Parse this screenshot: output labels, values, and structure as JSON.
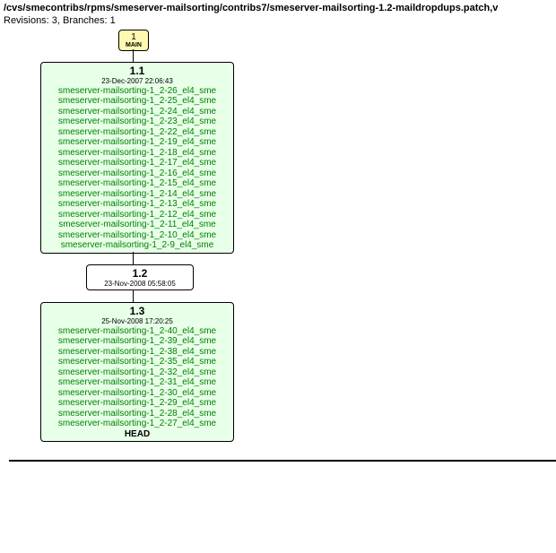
{
  "header": {
    "path": "/cvs/smecontribs/rpms/smeserver-mailsorting/contribs7/smeserver-mailsorting-1.2-maildropdups.patch,v",
    "revline": "Revisions: 3, Branches: 1"
  },
  "main": {
    "num": "1",
    "label": "MAIN"
  },
  "node1": {
    "version": "1.1",
    "date": "23-Dec-2007 22:06:43",
    "tags": [
      "smeserver-mailsorting-1_2-26_el4_sme",
      "smeserver-mailsorting-1_2-25_el4_sme",
      "smeserver-mailsorting-1_2-24_el4_sme",
      "smeserver-mailsorting-1_2-23_el4_sme",
      "smeserver-mailsorting-1_2-22_el4_sme",
      "smeserver-mailsorting-1_2-19_el4_sme",
      "smeserver-mailsorting-1_2-18_el4_sme",
      "smeserver-mailsorting-1_2-17_el4_sme",
      "smeserver-mailsorting-1_2-16_el4_sme",
      "smeserver-mailsorting-1_2-15_el4_sme",
      "smeserver-mailsorting-1_2-14_el4_sme",
      "smeserver-mailsorting-1_2-13_el4_sme",
      "smeserver-mailsorting-1_2-12_el4_sme",
      "smeserver-mailsorting-1_2-11_el4_sme",
      "smeserver-mailsorting-1_2-10_el4_sme",
      "smeserver-mailsorting-1_2-9_el4_sme"
    ]
  },
  "node2": {
    "version": "1.2",
    "date": "23-Nov-2008 05:58:05"
  },
  "node3": {
    "version": "1.3",
    "date": "25-Nov-2008 17:20:25",
    "tags": [
      "smeserver-mailsorting-1_2-40_el4_sme",
      "smeserver-mailsorting-1_2-39_el4_sme",
      "smeserver-mailsorting-1_2-38_el4_sme",
      "smeserver-mailsorting-1_2-35_el4_sme",
      "smeserver-mailsorting-1_2-32_el4_sme",
      "smeserver-mailsorting-1_2-31_el4_sme",
      "smeserver-mailsorting-1_2-30_el4_sme",
      "smeserver-mailsorting-1_2-29_el4_sme",
      "smeserver-mailsorting-1_2-28_el4_sme",
      "smeserver-mailsorting-1_2-27_el4_sme"
    ],
    "head": "HEAD"
  }
}
